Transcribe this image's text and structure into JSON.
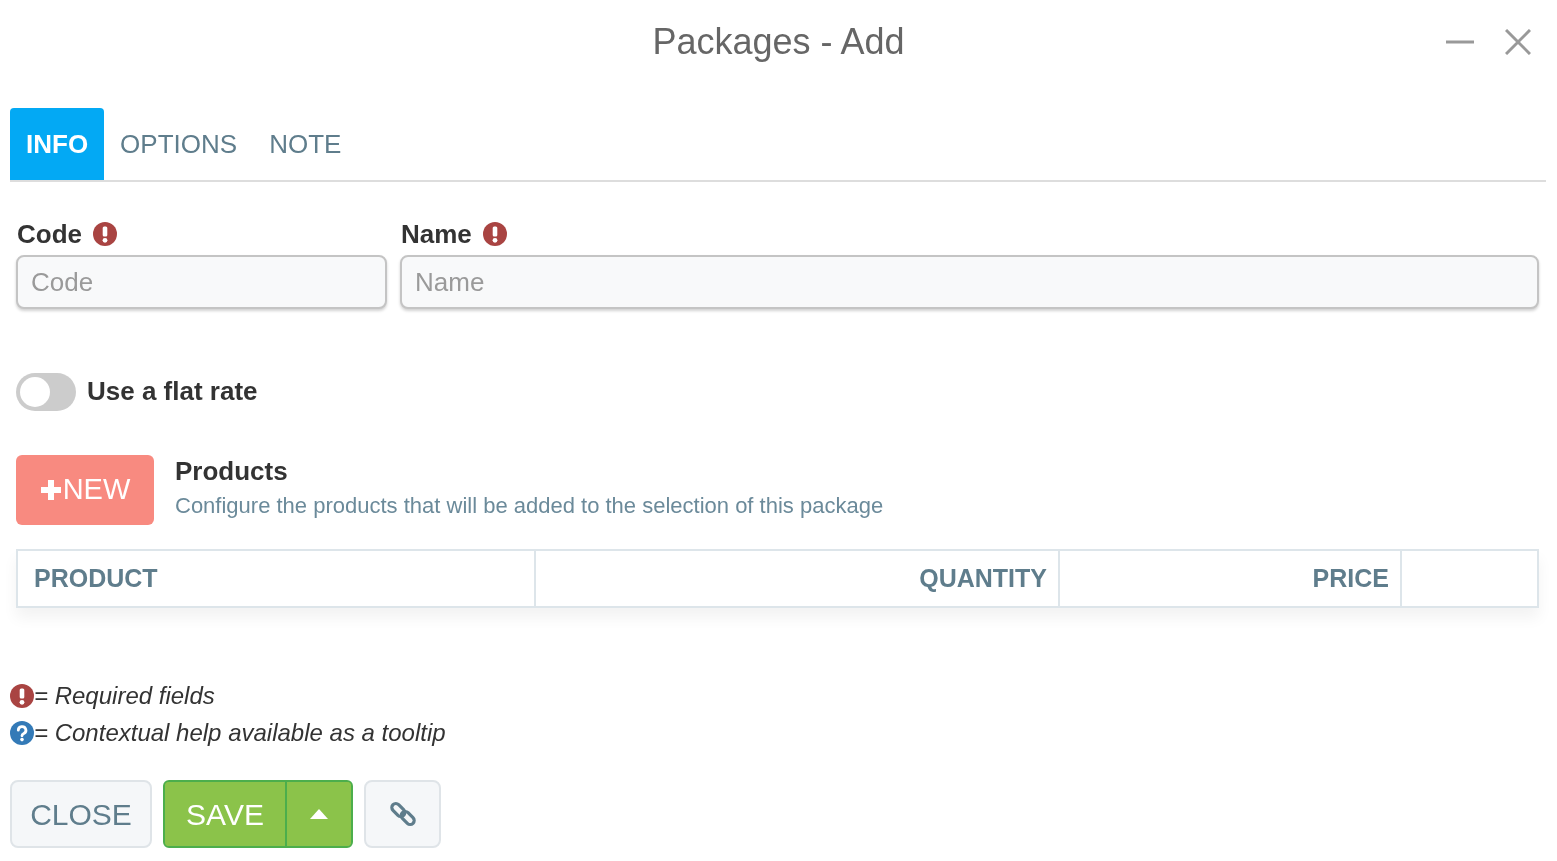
{
  "window": {
    "title": "Packages - Add"
  },
  "tabs": [
    {
      "label": "INFO",
      "selected": true
    },
    {
      "label": "OPTIONS",
      "selected": false
    },
    {
      "label": "NOTE",
      "selected": false
    }
  ],
  "fields": [
    {
      "label": "Code",
      "required": true,
      "placeholder": "Code"
    },
    {
      "label": "Name",
      "required": true,
      "placeholder": "Name"
    }
  ],
  "flat_rate": {
    "label": "Use a flat rate",
    "on": false
  },
  "products": {
    "new_button": "NEW",
    "title": "Products",
    "description": "Configure the products that will be added to the selection of this package",
    "columns": [
      "PRODUCT",
      "QUANTITY",
      "PRICE"
    ]
  },
  "legend": [
    {
      "kind": "required",
      "text": "= Required fields"
    },
    {
      "kind": "help",
      "text": "= Contextual help available as a tooltip"
    }
  ],
  "buttons": {
    "close": "CLOSE",
    "save": "SAVE"
  }
}
